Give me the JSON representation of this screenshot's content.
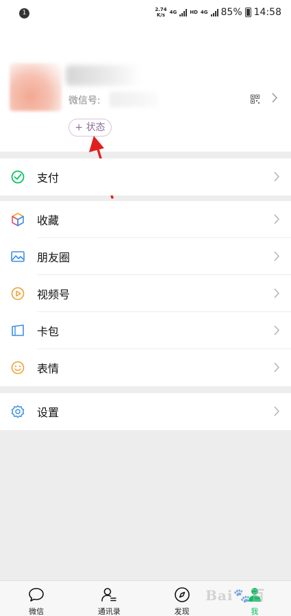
{
  "status_bar": {
    "notification_count": "1",
    "net_speed_value": "2.74",
    "net_speed_unit": "K/s",
    "sig1": "4G",
    "hd": "HD",
    "sig2": "4G",
    "battery": "85%",
    "time": "14:58"
  },
  "profile": {
    "wxid_label": "微信号:",
    "status_button": "+ 状态"
  },
  "menu": {
    "pay": "支付",
    "items": [
      {
        "label": "收藏",
        "icon": "favorites-cube-icon"
      },
      {
        "label": "朋友圈",
        "icon": "moments-photo-icon"
      },
      {
        "label": "视频号",
        "icon": "channels-play-icon"
      },
      {
        "label": "卡包",
        "icon": "card-wallet-icon"
      },
      {
        "label": "表情",
        "icon": "sticker-smile-icon"
      }
    ],
    "settings": "设置"
  },
  "bottom_nav": {
    "tabs": [
      {
        "label": "微信",
        "icon": "chat-bubble-icon"
      },
      {
        "label": "通讯录",
        "icon": "contacts-icon"
      },
      {
        "label": "发现",
        "icon": "compass-icon"
      },
      {
        "label": "我",
        "icon": "me-person-icon",
        "active": true
      }
    ]
  },
  "colors": {
    "accent": "#07c160",
    "annotation_arrow": "#e02020",
    "status_pill": "#8d6f9a"
  }
}
